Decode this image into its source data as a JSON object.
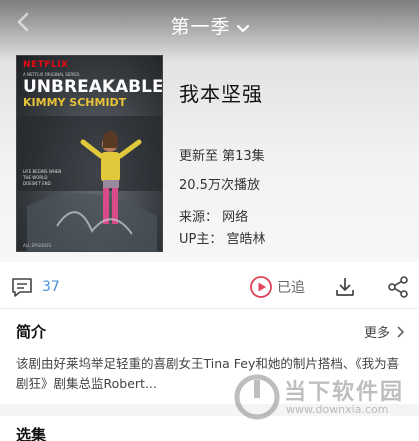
{
  "header": {
    "season_label": "第一季"
  },
  "poster": {
    "brand": "NETFLIX",
    "subtitle": "A NETFLIX ORIGINAL SERIES",
    "title_line1": "UNBREAKABLE",
    "title_line2": "KIMMY SCHMIDT",
    "tagline": "LIFE BEGINS WHEN THE WORLD DOESN'T END",
    "episodes": "ALL EPISODES"
  },
  "show": {
    "title": "我本坚强",
    "update": "更新至 第13集",
    "plays": "20.5万次播放",
    "source": "来源： 网络",
    "uploader": "UP主： 宫皓林"
  },
  "actions": {
    "comment_count": "37",
    "followed_label": "已追",
    "accent": "#e0435a"
  },
  "intro": {
    "heading": "简介",
    "more_label": "更多",
    "text": "该剧由好莱坞举足轻重的喜剧女王Tina Fey和她的制片搭档、《我为喜剧狂》剧集总监Robert..."
  },
  "episodes_section": {
    "heading": "选集"
  },
  "watermark": {
    "name": "当下软件园",
    "url": "www.downxia.com"
  }
}
